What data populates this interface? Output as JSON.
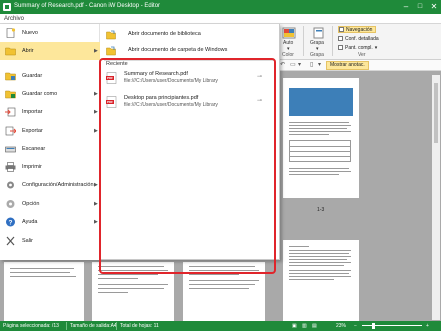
{
  "window": {
    "title": "Summary of Research.pdf - Canon iW Desktop - Editor",
    "minimize": "–",
    "maximize": "□",
    "close": "✕"
  },
  "menubar": {
    "archivo": "Archivo"
  },
  "ribbon": {
    "auto_label": "Auto",
    "color_label": "Color",
    "grapa_label": "Grapa",
    "grapa2_label": "Grapa",
    "ver_label": "Ver",
    "checks": [
      "Navegación",
      "Conf. detallada",
      "Pant. compl."
    ],
    "checks_selected": 0,
    "mostrar": "Mostrar anotac."
  },
  "file_menu": {
    "items": [
      {
        "label": "Nuevo",
        "icon": "new-document-icon",
        "arrow": ""
      },
      {
        "label": "Abrir",
        "icon": "open-folder-icon",
        "arrow": "▶"
      },
      {
        "label": "Guardar",
        "icon": "save-folder-icon",
        "arrow": ""
      },
      {
        "label": "Guardar como",
        "icon": "save-as-icon",
        "arrow": "▶"
      },
      {
        "label": "Importar",
        "icon": "import-icon",
        "arrow": "▶"
      },
      {
        "label": "Exportar",
        "icon": "export-icon",
        "arrow": "▶"
      },
      {
        "label": "Escanear",
        "icon": "scan-icon",
        "arrow": ""
      },
      {
        "label": "Imprimir",
        "icon": "print-icon",
        "arrow": ""
      },
      {
        "label": "Configuración/Administración",
        "icon": "gear-icon",
        "arrow": "▶"
      },
      {
        "label": "Opción",
        "icon": "option-icon",
        "arrow": "▶"
      },
      {
        "label": "Ayuda",
        "icon": "help-icon",
        "arrow": "▶"
      },
      {
        "label": "Salir",
        "icon": "exit-icon",
        "arrow": ""
      }
    ],
    "active_index": 1,
    "submenu": {
      "open_library": "Abrir documento de biblioteca",
      "open_windows": "Abrir documento de carpeta de Windows",
      "recent_title": "Reciente",
      "recent": [
        {
          "name": "Summary of Research.pdf",
          "path": "file:///C:/Users/user/Documents/My Library"
        },
        {
          "name": "Desktop para principiantes.pdf",
          "path": "file:///C:/Users/user/Documents/My Library"
        }
      ]
    }
  },
  "workspace": {
    "page_number": "1-3"
  },
  "statusbar": {
    "selected_page": "Página seleccionada: /13",
    "output_size": "Tamaño de salida:A4",
    "total_pages": "Total de hojas: 11",
    "zoom": "23%"
  },
  "colors": {
    "accent_green": "#1f8a3a",
    "highlight_yellow": "#fde79b",
    "recent_border_red": "#e0252b"
  }
}
